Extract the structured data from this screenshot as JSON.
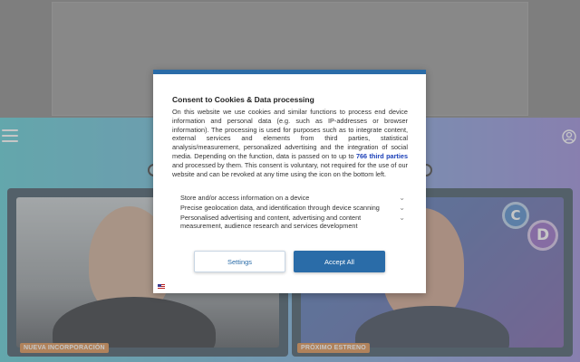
{
  "badges": {
    "left": "NUEVA INCORPORACIÓN",
    "right": "PRÓXIMO ESTRENO"
  },
  "letters": [
    "C",
    "D"
  ],
  "consent": {
    "title": "Consent to Cookies & Data processing",
    "body_before_link": "On this website we use cookies and similar functions to process end device information and personal data (e.g. such as IP-addresses or browser information). The processing is used for purposes such as to integrate content, external services and elements from third parties, statistical analysis/measurement, personalized advertising and the integration of social media. Depending on the function, data is passed on to up to",
    "link_text": "766 third parties",
    "body_after_link": "and processed by them. This consent is voluntary, not required for the use of our website and can be revoked at any time using the icon on the bottom left.",
    "purposes": [
      "Store and/or access information on a device",
      "Precise geolocation data, and identification through device scanning",
      "Personalised advertising and content, advertising and content measurement, audience research and services development"
    ],
    "settings_label": "Settings",
    "accept_label": "Accept All"
  },
  "icons": {
    "menu": "hamburger-menu-icon",
    "user": "user-account-icon",
    "chevron": "chevron-down-icon",
    "flag": "language-flag-icon"
  }
}
